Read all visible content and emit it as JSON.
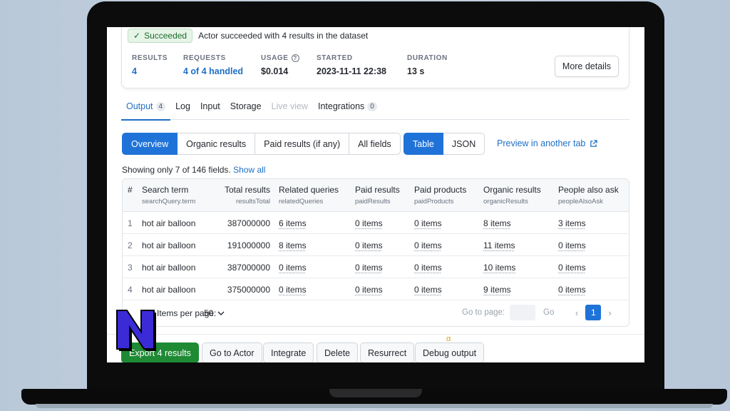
{
  "status": {
    "badge": "Succeeded",
    "message": "Actor succeeded with 4 results in the dataset"
  },
  "metrics": {
    "results_label": "RESULTS",
    "results_value": "4",
    "requests_label": "REQUESTS",
    "requests_value": "4 of 4 handled",
    "usage_label": "USAGE",
    "usage_value": "$0.014",
    "started_label": "STARTED",
    "started_value": "2023-11-11 22:38",
    "duration_label": "DURATION",
    "duration_value": "13 s",
    "more_details": "More details"
  },
  "tabs": [
    {
      "label": "Output",
      "count": "4"
    },
    {
      "label": "Log"
    },
    {
      "label": "Input"
    },
    {
      "label": "Storage"
    },
    {
      "label": "Live view"
    },
    {
      "label": "Integrations",
      "count": "0"
    }
  ],
  "view_options": [
    "Overview",
    "Organic results",
    "Paid results (if any)",
    "All fields"
  ],
  "format_options": [
    "Table",
    "JSON"
  ],
  "preview_link": "Preview in another tab",
  "showing": {
    "text": "Showing only 7 of 146 fields.",
    "link": "Show all"
  },
  "table": {
    "headers": [
      {
        "title": "#",
        "sub": ""
      },
      {
        "title": "Search term",
        "sub": "searchQuery.term"
      },
      {
        "title": "Total results",
        "sub": "resultsTotal"
      },
      {
        "title": "Related queries",
        "sub": "relatedQueries"
      },
      {
        "title": "Paid results",
        "sub": "paidResults"
      },
      {
        "title": "Paid products",
        "sub": "paidProducts"
      },
      {
        "title": "Organic results",
        "sub": "organicResults"
      },
      {
        "title": "People also ask",
        "sub": "peopleAlsoAsk"
      }
    ],
    "rows": [
      [
        "1",
        "hot air balloon",
        "387000000",
        "6 items",
        "0 items",
        "0 items",
        "8 items",
        "3 items"
      ],
      [
        "2",
        "hot air balloon",
        "191000000",
        "8 items",
        "0 items",
        "0 items",
        "11 items",
        "0 items"
      ],
      [
        "3",
        "hot air balloon",
        "387000000",
        "0 items",
        "0 items",
        "0 items",
        "10 items",
        "0 items"
      ],
      [
        "4",
        "hot air balloon",
        "375000000",
        "0 items",
        "0 items",
        "0 items",
        "9 items",
        "0 items"
      ]
    ]
  },
  "pagination": {
    "per_page_label": "Items per page:",
    "per_page_value": "50",
    "goto_label": "Go to page:",
    "go_button": "Go",
    "current_page": "1"
  },
  "bottom_actions": {
    "export": "Export 4 results",
    "goto_actor": "Go to Actor",
    "integrate": "Integrate",
    "delete": "Delete",
    "resurrect": "Resurrect",
    "debug": "Debug output",
    "alpha": "α"
  },
  "colors": {
    "accent": "#1f73d8",
    "success": "#1e8a34",
    "logo_fill": "#3b2bd6"
  }
}
